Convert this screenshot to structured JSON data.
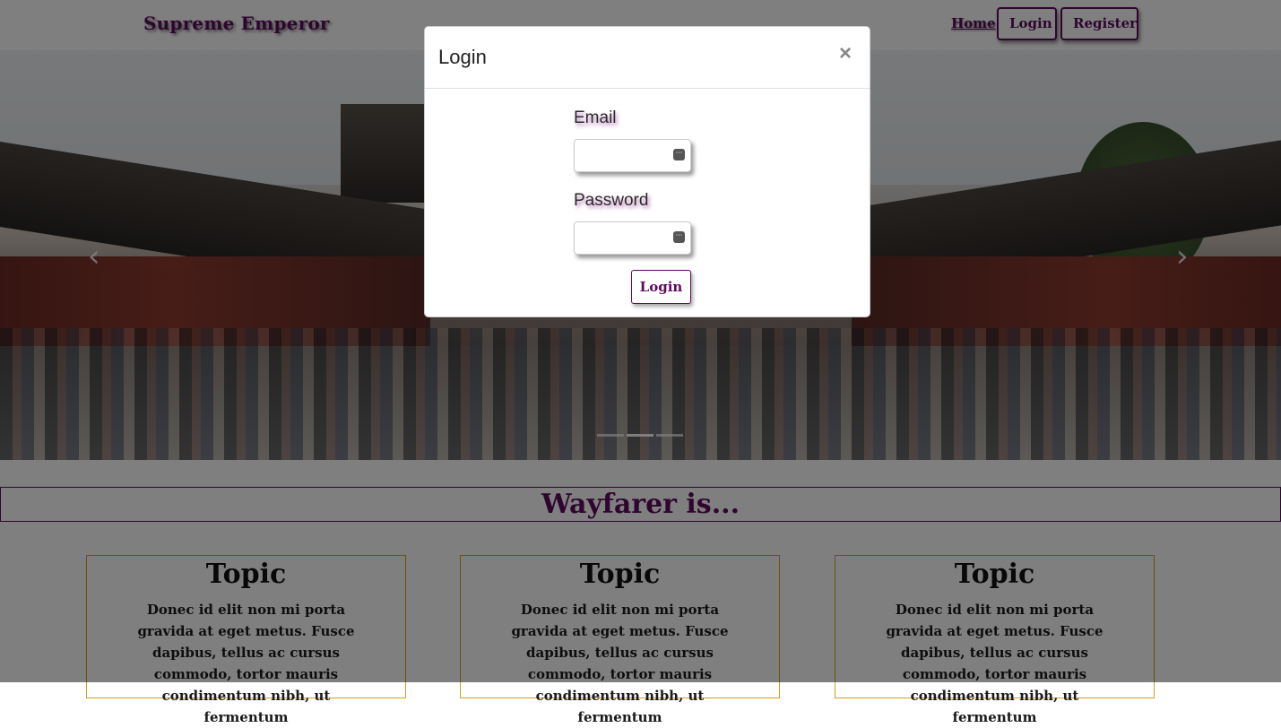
{
  "navbar": {
    "brand": "Supreme Emperor",
    "home_label": "Home",
    "login_label": "Login",
    "register_label": "Register"
  },
  "carousel": {
    "prev_icon": "chevron-left-icon",
    "next_icon": "chevron-right-icon"
  },
  "content": {
    "section_title": "Wayfarer is...",
    "topics": [
      {
        "title": "Topic",
        "text": "Donec id elit non mi porta gravida at eget metus. Fusce dapibus, tellus ac cursus commodo, tortor mauris condimentum nibh, ut fermentum"
      },
      {
        "title": "Topic",
        "text": "Donec id elit non mi porta gravida at eget metus. Fusce dapibus, tellus ac cursus commodo, tortor mauris condimentum nibh, ut fermentum"
      },
      {
        "title": "Topic",
        "text": "Donec id elit non mi porta gravida at eget metus. Fusce dapibus, tellus ac cursus commodo, tortor mauris condimentum nibh, ut fermentum"
      }
    ]
  },
  "modal": {
    "title": "Login",
    "close_symbol": "×",
    "email_label": "Email",
    "email_value": "",
    "password_label": "Password",
    "password_value": "",
    "input_icon": "···",
    "submit_label": "Login"
  },
  "colors": {
    "brand": "#5f0a5f",
    "topic_border": "#d4a017"
  }
}
